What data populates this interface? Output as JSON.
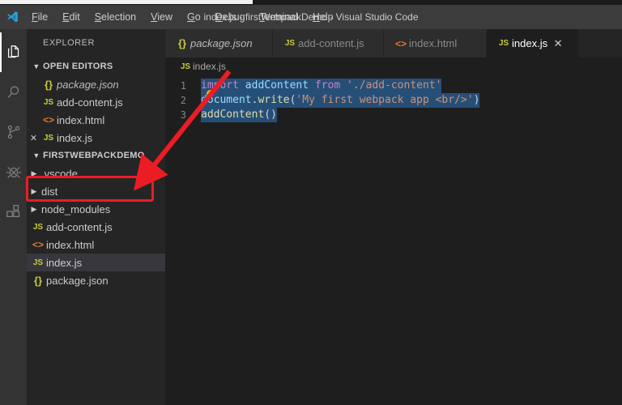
{
  "window": {
    "title": "index.js - firstWebpackDemo - Visual Studio Code",
    "logo_icon": "vscode-logo-icon"
  },
  "menubar": {
    "items": [
      {
        "label": "File",
        "mnemonic": "F"
      },
      {
        "label": "Edit",
        "mnemonic": "E"
      },
      {
        "label": "Selection",
        "mnemonic": "S"
      },
      {
        "label": "View",
        "mnemonic": "V"
      },
      {
        "label": "Go",
        "mnemonic": "G"
      },
      {
        "label": "Debug",
        "mnemonic": "D"
      },
      {
        "label": "Terminal",
        "mnemonic": "T"
      },
      {
        "label": "Help",
        "mnemonic": "H"
      }
    ]
  },
  "activity_bar": {
    "items": [
      {
        "name": "explorer",
        "icon": "files-icon",
        "active": true
      },
      {
        "name": "search",
        "icon": "search-icon",
        "active": false
      },
      {
        "name": "source-control",
        "icon": "source-control-icon",
        "active": false
      },
      {
        "name": "debug",
        "icon": "debug-icon",
        "active": false
      },
      {
        "name": "extensions",
        "icon": "extensions-icon",
        "active": false
      }
    ]
  },
  "sidebar": {
    "title": "EXPLORER",
    "open_editors": {
      "header": "OPEN EDITORS",
      "expanded": true,
      "twisty_icon": "chevron-down-icon",
      "items": [
        {
          "label": "package.json",
          "icon": "json-icon",
          "italic": true,
          "dirty": false,
          "selected": false,
          "close_icon": ""
        },
        {
          "label": "add-content.js",
          "icon": "js-icon",
          "italic": false,
          "dirty": false,
          "selected": false,
          "close_icon": ""
        },
        {
          "label": "index.html",
          "icon": "html-icon",
          "italic": false,
          "dirty": false,
          "selected": false,
          "close_icon": ""
        },
        {
          "label": "index.js",
          "icon": "js-icon",
          "italic": false,
          "dirty": false,
          "selected": false,
          "close_icon": "✕"
        }
      ]
    },
    "workspace": {
      "header": "FIRSTWEBPACKDEMO",
      "expanded": true,
      "twisty_icon": "chevron-down-icon",
      "items": [
        {
          "label": ".vscode",
          "kind": "folder",
          "icon": "chevron-right-icon",
          "expanded": false,
          "selected": false
        },
        {
          "label": "dist",
          "kind": "folder",
          "icon": "chevron-right-icon",
          "expanded": false,
          "selected": false
        },
        {
          "label": "node_modules",
          "kind": "folder",
          "icon": "chevron-right-icon",
          "expanded": false,
          "selected": false
        },
        {
          "label": "add-content.js",
          "kind": "file",
          "icon": "js-icon",
          "selected": false
        },
        {
          "label": "index.html",
          "kind": "file",
          "icon": "html-icon",
          "selected": false
        },
        {
          "label": "index.js",
          "kind": "file",
          "icon": "js-icon",
          "selected": true
        },
        {
          "label": "package.json",
          "kind": "file",
          "icon": "json-icon",
          "selected": false
        }
      ]
    }
  },
  "editor": {
    "tabs": [
      {
        "label": "package.json",
        "icon": "json-icon",
        "italic": true,
        "active": false,
        "close_icon": ""
      },
      {
        "label": "add-content.js",
        "icon": "js-icon",
        "italic": false,
        "active": false,
        "close_icon": ""
      },
      {
        "label": "index.html",
        "icon": "html-icon",
        "italic": false,
        "active": false,
        "close_icon": ""
      },
      {
        "label": "index.js",
        "icon": "js-icon",
        "italic": false,
        "active": true,
        "close_icon": "✕"
      }
    ],
    "breadcrumb": {
      "icon": "js-icon",
      "label": "index.js"
    },
    "lines": [
      {
        "number": "1",
        "text": "import addContent from './add-content'"
      },
      {
        "number": "2",
        "text": "document.write('My first webpack app <br/>')"
      },
      {
        "number": "3",
        "text": "addContent()"
      }
    ]
  },
  "annotations": {
    "highlight_box": {
      "target": "dist",
      "color": "#ec1c24"
    },
    "arrow": {
      "color": "#ec1c24",
      "points_to": "dist"
    }
  },
  "colors": {
    "accent": "#007acc",
    "annotation_red": "#ec1c24",
    "selection_blue": "#264f78",
    "js_yellow": "#cbcb41",
    "html_orange": "#e37933"
  }
}
